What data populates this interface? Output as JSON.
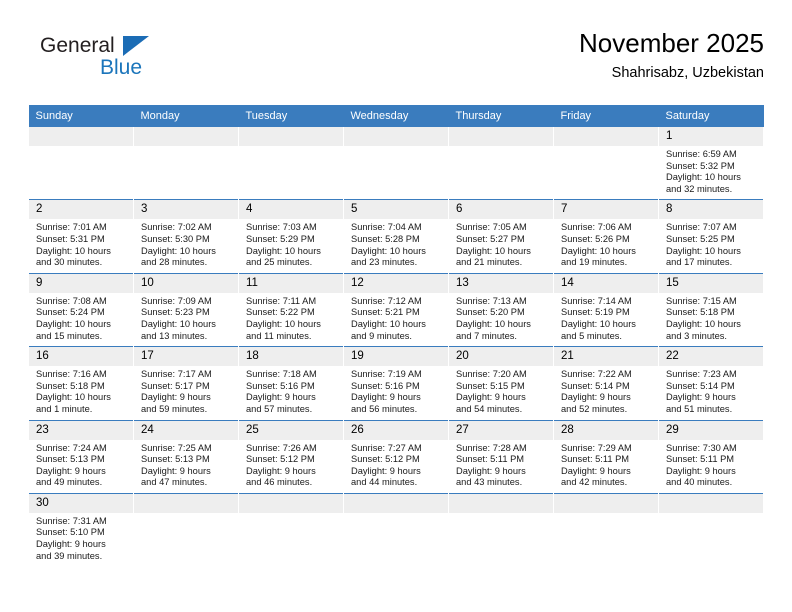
{
  "logo": {
    "word_one": "General",
    "word_two": "Blue",
    "triangle_color": "#1b6cb5",
    "blue_color": "#1b75bb"
  },
  "header": {
    "title": "November 2025",
    "subtitle": "Shahrisabz, Uzbekistan"
  },
  "theme": {
    "header_row_bg": "#3a7cbe",
    "daynum_bg": "#eeeeee",
    "grid_line": "#3a7cbe"
  },
  "columns": [
    "Sunday",
    "Monday",
    "Tuesday",
    "Wednesday",
    "Thursday",
    "Friday",
    "Saturday"
  ],
  "weeks": [
    [
      {
        "day": "",
        "empty": true
      },
      {
        "day": "",
        "empty": true
      },
      {
        "day": "",
        "empty": true
      },
      {
        "day": "",
        "empty": true
      },
      {
        "day": "",
        "empty": true
      },
      {
        "day": "",
        "empty": true
      },
      {
        "day": "1",
        "sunrise": "Sunrise: 6:59 AM",
        "sunset": "Sunset: 5:32 PM",
        "daylight_1": "Daylight: 10 hours",
        "daylight_2": "and 32 minutes."
      }
    ],
    [
      {
        "day": "2",
        "sunrise": "Sunrise: 7:01 AM",
        "sunset": "Sunset: 5:31 PM",
        "daylight_1": "Daylight: 10 hours",
        "daylight_2": "and 30 minutes."
      },
      {
        "day": "3",
        "sunrise": "Sunrise: 7:02 AM",
        "sunset": "Sunset: 5:30 PM",
        "daylight_1": "Daylight: 10 hours",
        "daylight_2": "and 28 minutes."
      },
      {
        "day": "4",
        "sunrise": "Sunrise: 7:03 AM",
        "sunset": "Sunset: 5:29 PM",
        "daylight_1": "Daylight: 10 hours",
        "daylight_2": "and 25 minutes."
      },
      {
        "day": "5",
        "sunrise": "Sunrise: 7:04 AM",
        "sunset": "Sunset: 5:28 PM",
        "daylight_1": "Daylight: 10 hours",
        "daylight_2": "and 23 minutes."
      },
      {
        "day": "6",
        "sunrise": "Sunrise: 7:05 AM",
        "sunset": "Sunset: 5:27 PM",
        "daylight_1": "Daylight: 10 hours",
        "daylight_2": "and 21 minutes."
      },
      {
        "day": "7",
        "sunrise": "Sunrise: 7:06 AM",
        "sunset": "Sunset: 5:26 PM",
        "daylight_1": "Daylight: 10 hours",
        "daylight_2": "and 19 minutes."
      },
      {
        "day": "8",
        "sunrise": "Sunrise: 7:07 AM",
        "sunset": "Sunset: 5:25 PM",
        "daylight_1": "Daylight: 10 hours",
        "daylight_2": "and 17 minutes."
      }
    ],
    [
      {
        "day": "9",
        "sunrise": "Sunrise: 7:08 AM",
        "sunset": "Sunset: 5:24 PM",
        "daylight_1": "Daylight: 10 hours",
        "daylight_2": "and 15 minutes."
      },
      {
        "day": "10",
        "sunrise": "Sunrise: 7:09 AM",
        "sunset": "Sunset: 5:23 PM",
        "daylight_1": "Daylight: 10 hours",
        "daylight_2": "and 13 minutes."
      },
      {
        "day": "11",
        "sunrise": "Sunrise: 7:11 AM",
        "sunset": "Sunset: 5:22 PM",
        "daylight_1": "Daylight: 10 hours",
        "daylight_2": "and 11 minutes."
      },
      {
        "day": "12",
        "sunrise": "Sunrise: 7:12 AM",
        "sunset": "Sunset: 5:21 PM",
        "daylight_1": "Daylight: 10 hours",
        "daylight_2": "and 9 minutes."
      },
      {
        "day": "13",
        "sunrise": "Sunrise: 7:13 AM",
        "sunset": "Sunset: 5:20 PM",
        "daylight_1": "Daylight: 10 hours",
        "daylight_2": "and 7 minutes."
      },
      {
        "day": "14",
        "sunrise": "Sunrise: 7:14 AM",
        "sunset": "Sunset: 5:19 PM",
        "daylight_1": "Daylight: 10 hours",
        "daylight_2": "and 5 minutes."
      },
      {
        "day": "15",
        "sunrise": "Sunrise: 7:15 AM",
        "sunset": "Sunset: 5:18 PM",
        "daylight_1": "Daylight: 10 hours",
        "daylight_2": "and 3 minutes."
      }
    ],
    [
      {
        "day": "16",
        "sunrise": "Sunrise: 7:16 AM",
        "sunset": "Sunset: 5:18 PM",
        "daylight_1": "Daylight: 10 hours",
        "daylight_2": "and 1 minute."
      },
      {
        "day": "17",
        "sunrise": "Sunrise: 7:17 AM",
        "sunset": "Sunset: 5:17 PM",
        "daylight_1": "Daylight: 9 hours",
        "daylight_2": "and 59 minutes."
      },
      {
        "day": "18",
        "sunrise": "Sunrise: 7:18 AM",
        "sunset": "Sunset: 5:16 PM",
        "daylight_1": "Daylight: 9 hours",
        "daylight_2": "and 57 minutes."
      },
      {
        "day": "19",
        "sunrise": "Sunrise: 7:19 AM",
        "sunset": "Sunset: 5:16 PM",
        "daylight_1": "Daylight: 9 hours",
        "daylight_2": "and 56 minutes."
      },
      {
        "day": "20",
        "sunrise": "Sunrise: 7:20 AM",
        "sunset": "Sunset: 5:15 PM",
        "daylight_1": "Daylight: 9 hours",
        "daylight_2": "and 54 minutes."
      },
      {
        "day": "21",
        "sunrise": "Sunrise: 7:22 AM",
        "sunset": "Sunset: 5:14 PM",
        "daylight_1": "Daylight: 9 hours",
        "daylight_2": "and 52 minutes."
      },
      {
        "day": "22",
        "sunrise": "Sunrise: 7:23 AM",
        "sunset": "Sunset: 5:14 PM",
        "daylight_1": "Daylight: 9 hours",
        "daylight_2": "and 51 minutes."
      }
    ],
    [
      {
        "day": "23",
        "sunrise": "Sunrise: 7:24 AM",
        "sunset": "Sunset: 5:13 PM",
        "daylight_1": "Daylight: 9 hours",
        "daylight_2": "and 49 minutes."
      },
      {
        "day": "24",
        "sunrise": "Sunrise: 7:25 AM",
        "sunset": "Sunset: 5:13 PM",
        "daylight_1": "Daylight: 9 hours",
        "daylight_2": "and 47 minutes."
      },
      {
        "day": "25",
        "sunrise": "Sunrise: 7:26 AM",
        "sunset": "Sunset: 5:12 PM",
        "daylight_1": "Daylight: 9 hours",
        "daylight_2": "and 46 minutes."
      },
      {
        "day": "26",
        "sunrise": "Sunrise: 7:27 AM",
        "sunset": "Sunset: 5:12 PM",
        "daylight_1": "Daylight: 9 hours",
        "daylight_2": "and 44 minutes."
      },
      {
        "day": "27",
        "sunrise": "Sunrise: 7:28 AM",
        "sunset": "Sunset: 5:11 PM",
        "daylight_1": "Daylight: 9 hours",
        "daylight_2": "and 43 minutes."
      },
      {
        "day": "28",
        "sunrise": "Sunrise: 7:29 AM",
        "sunset": "Sunset: 5:11 PM",
        "daylight_1": "Daylight: 9 hours",
        "daylight_2": "and 42 minutes."
      },
      {
        "day": "29",
        "sunrise": "Sunrise: 7:30 AM",
        "sunset": "Sunset: 5:11 PM",
        "daylight_1": "Daylight: 9 hours",
        "daylight_2": "and 40 minutes."
      }
    ],
    [
      {
        "day": "30",
        "sunrise": "Sunrise: 7:31 AM",
        "sunset": "Sunset: 5:10 PM",
        "daylight_1": "Daylight: 9 hours",
        "daylight_2": "and 39 minutes."
      },
      {
        "day": "",
        "empty": true
      },
      {
        "day": "",
        "empty": true
      },
      {
        "day": "",
        "empty": true
      },
      {
        "day": "",
        "empty": true
      },
      {
        "day": "",
        "empty": true
      },
      {
        "day": "",
        "empty": true
      }
    ]
  ]
}
